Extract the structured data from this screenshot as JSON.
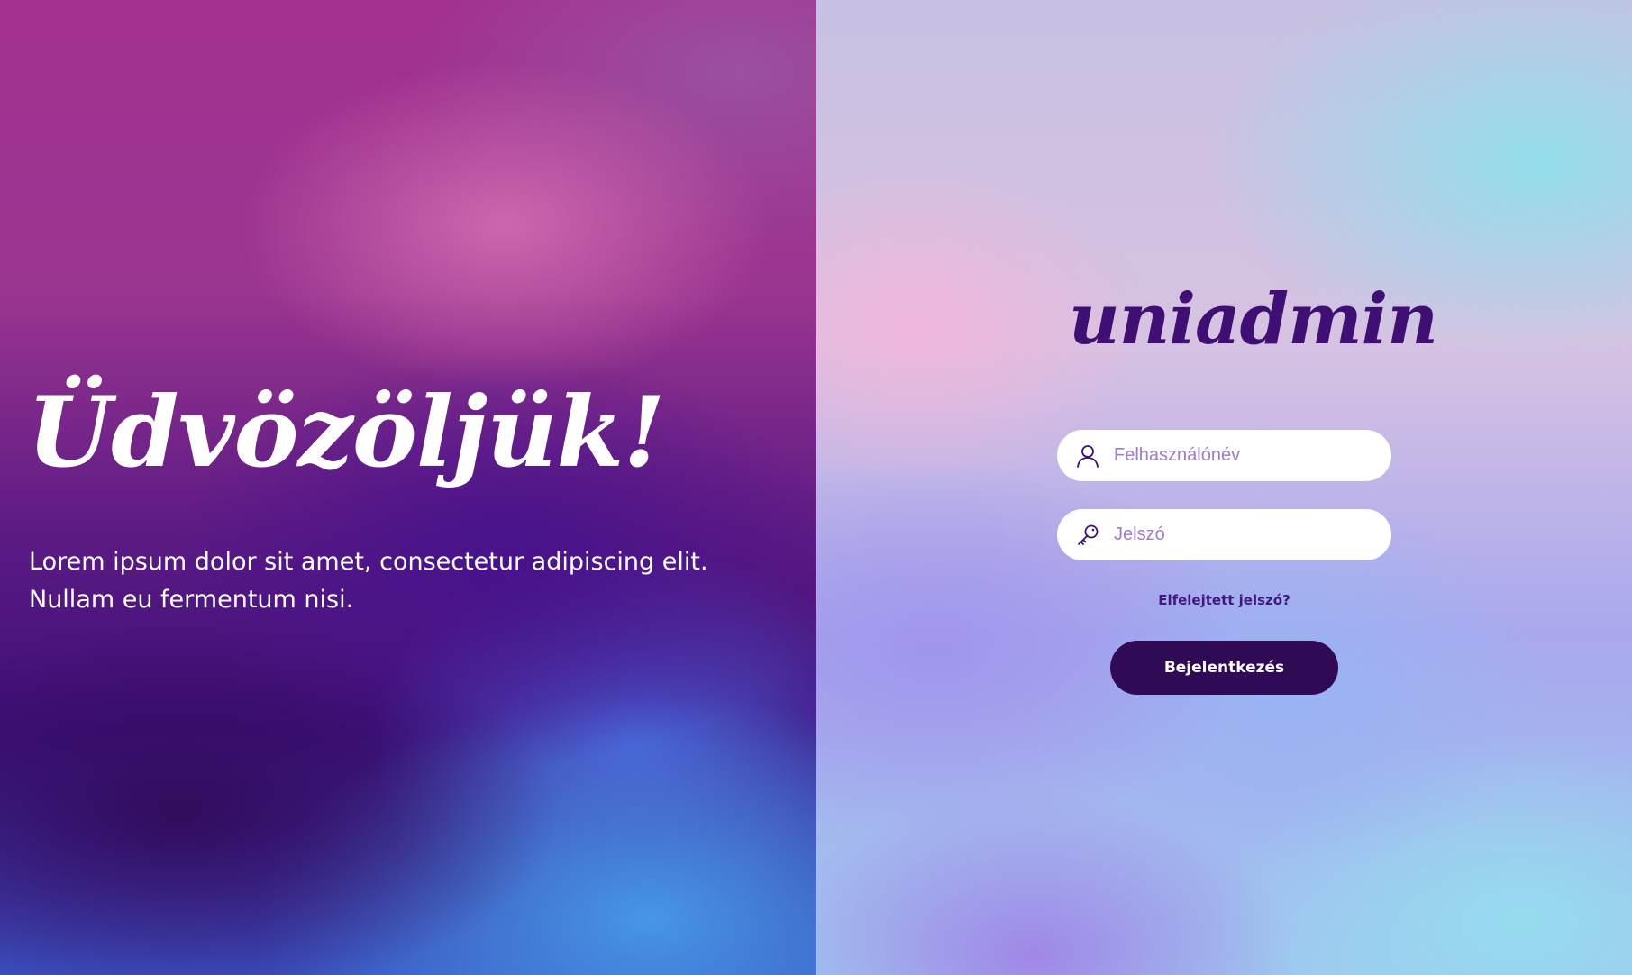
{
  "hero": {
    "title": "Üdvözöljük!",
    "text_line1": "Lorem ipsum dolor sit amet, consectetur adipiscing elit.",
    "text_line2": "Nullam eu fermentum nisi."
  },
  "login": {
    "logo": "uniadmin",
    "username": {
      "placeholder": "Felhasználónév",
      "value": "",
      "icon": "user-icon"
    },
    "password": {
      "placeholder": "Jelszó",
      "value": "",
      "icon": "key-icon"
    },
    "forgot_label": "Elfelejtett jelszó?",
    "submit_label": "Bejelentkezés"
  },
  "colors": {
    "accent_dark": "#310a55",
    "logo": "#3f0f73",
    "placeholder": "#a07cc6"
  }
}
